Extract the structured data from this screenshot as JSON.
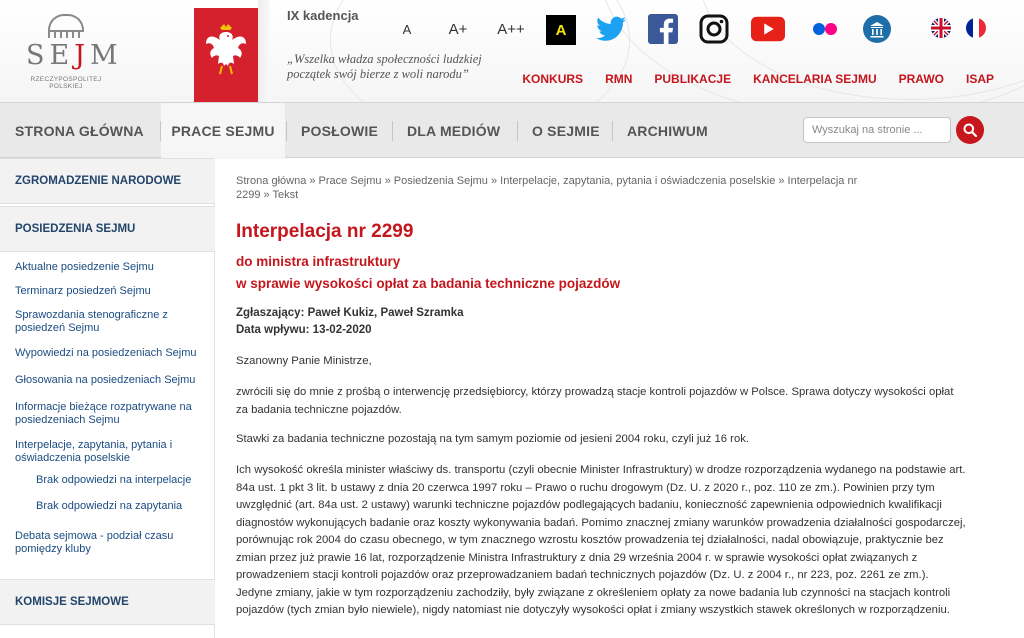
{
  "header": {
    "logo_word": "SEJM",
    "logo_sub": "RZECZYPOSPOLITEJ POLSKIEJ",
    "kadencja": "IX kadencja",
    "quote_line1": "„Wszelka władza społeczności ludzkiej",
    "quote_line2": "początek swój bierze z woli narodu”",
    "font_sizes": [
      "A",
      "A+",
      "A++"
    ],
    "contrast_label": "A",
    "social": [
      "twitter-icon",
      "facebook-icon",
      "instagram-icon",
      "youtube-icon",
      "flickr-icon",
      "museum-icon"
    ],
    "languages": [
      "english-flag-icon",
      "french-flag-icon"
    ],
    "top_links": [
      "KONKURS",
      "RMN",
      "PUBLIKACJE",
      "KANCELARIA SEJMU",
      "PRAWO",
      "ISAP"
    ]
  },
  "nav": {
    "items": [
      "STRONA GŁÓWNA",
      "PRACE SEJMU",
      "POSŁOWIE",
      "DLA MEDIÓW",
      "O SEJMIE",
      "ARCHIWUM"
    ],
    "search_placeholder": "Wyszukaj na stronie ..."
  },
  "sidebar": {
    "head1": "ZGROMADZENIE NARODOWE",
    "head2": "POSIEDZENIA SEJMU",
    "links": [
      "Aktualne posiedzenie Sejmu",
      "Terminarz posiedzeń Sejmu",
      "Sprawozdania stenograficzne z posiedzeń Sejmu",
      "Wypowiedzi na posiedzeniach Sejmu",
      "Głosowania na posiedzeniach Sejmu",
      "Informacje bieżące rozpatrywane na posiedzeniach Sejmu",
      "Interpelacje, zapytania, pytania i oświadczenia poselskie",
      "Debata sejmowa - podział czasu pomiędzy kluby"
    ],
    "sublinks": [
      "Brak odpowiedzi na interpelacje",
      "Brak odpowiedzi na zapytania"
    ],
    "head3": "KOMISJE SEJMOWE"
  },
  "content": {
    "breadcrumb_line1": "Strona główna  »  Prace Sejmu  »  Posiedzenia Sejmu  »  Interpelacje, zapytania, pytania i oświadczenia poselskie  »  Interpelacja nr",
    "breadcrumb_line2": "2299  »  Tekst",
    "title": "Interpelacja nr 2299",
    "subtitle1": "do ministra infrastruktury",
    "subtitle2": "w sprawie wysokości opłat za badania techniczne pojazdów",
    "submitters": "Zgłaszający: Paweł Kukiz, Paweł Szramka",
    "date": "Data wpływu: 13-02-2020",
    "salutation": "Szanowny Panie Ministrze,",
    "p1": "zwrócili się do mnie z prośbą o interwencję przedsiębiorcy, którzy prowadzą stacje kontroli pojazdów w Polsce. Sprawa dotyczy wysokości opłat za badania techniczne pojazdów.",
    "p2": "Stawki za badania techniczne pozostają na tym samym poziomie od jesieni 2004 roku, czyli już 16 rok.",
    "p3": "Ich wysokość określa minister właściwy ds. transportu (czyli obecnie Minister Infrastruktury) w drodze rozporządzenia wydanego na podstawie art. 84a ust. 1 pkt 3 lit. b ustawy z dnia 20 czerwca 1997 roku – Prawo o ruchu drogowym (Dz. U. z 2020 r., poz. 110 ze zm.). Powinien przy tym uwzględnić (art. 84a ust. 2 ustawy) warunki techniczne pojazdów podlegających badaniu, konieczność zapewnienia odpowiednich kwalifikacji diagnostów wykonujących badanie oraz koszty wykonywania badań. Pomimo znacznej zmiany warunków prowadzenia działalności gospodarczej, porównując rok 2004 do czasu obecnego, w tym znacznego wzrostu kosztów prowadzenia tej działalności, nadal obowiązuje, praktycznie bez zmian przez już prawie 16 lat, rozporządzenie Ministra Infrastruktury z dnia 29 września 2004 r. w sprawie wysokości opłat związanych z prowadzeniem stacji kontroli pojazdów oraz przeprowadzaniem badań technicznych pojazdów (Dz. U. z 2004 r., nr 223, poz. 2261 ze zm.). Jedyne zmiany, jakie w tym rozporządzeniu zachodziły, były związane z określeniem opłaty za nowe badania lub czynności na stacjach kontroli pojazdów (tych zmian było niewiele), nigdy natomiast nie dotyczyły wysokości opłat i zmiany wszystkich stawek określonych w rozporządzeniu."
  },
  "colors": {
    "brand_red": "#c4161c",
    "link_blue": "#1b4c82",
    "nav_bg": "#e9e9e9"
  }
}
